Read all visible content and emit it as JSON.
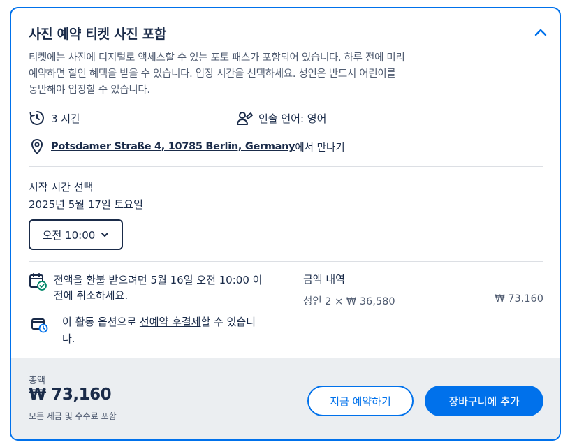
{
  "card": {
    "title": "사진 예약 티켓 사진 포함",
    "description": "티켓에는 사진에 디지털로 액세스할 수 있는 포토 패스가 포함되어 있습니다. 하루 전에 미리 예약하면 할인 혜택을 받을 수 있습니다. 입장 시간을 선택하세요. 성인은 반드시 어린이를 동반해야 입장할 수 있습니다.",
    "duration": "3 시간",
    "guide_language": "인솔 언어: 영어",
    "meeting_point_address": "Potsdamer Straße 4, 10785 Berlin, Germany",
    "meeting_point_suffix": "에서 만나기"
  },
  "schedule": {
    "label": "시작 시간 선택",
    "date": "2025년 5월 17일 토요일",
    "time_value": "오전 10:00"
  },
  "policy": {
    "cancel_text": "전액을 환불 받으려면 5월 16일 오전 10:00 이전에 취소하세요.",
    "pay_prefix": "이 활동 옵션으로 ",
    "pay_link": "선예약 후결제",
    "pay_suffix": "할 수 있습니다."
  },
  "price": {
    "title": "금액 내역",
    "line_label": "성인 2 × ₩ 36,580",
    "line_amount": "₩ 73,160"
  },
  "footer": {
    "total_label": "총액",
    "total_value": "₩ 73,160",
    "total_note": "모든 세금 및 수수료 포함",
    "reserve_label": "지금 예약하기",
    "cart_label": "장바구니에 추가"
  },
  "colors": {
    "accent": "#0071eb",
    "text": "#1a2b49",
    "muted": "#4f5b70",
    "success": "#008768",
    "footer_bg": "#ebeef1"
  },
  "icons": [
    "chevron-up-icon",
    "clock-history-icon",
    "guide-person-icon",
    "location-pin-icon",
    "chevron-down-icon",
    "calendar-check-icon",
    "wallet-clock-icon"
  ]
}
